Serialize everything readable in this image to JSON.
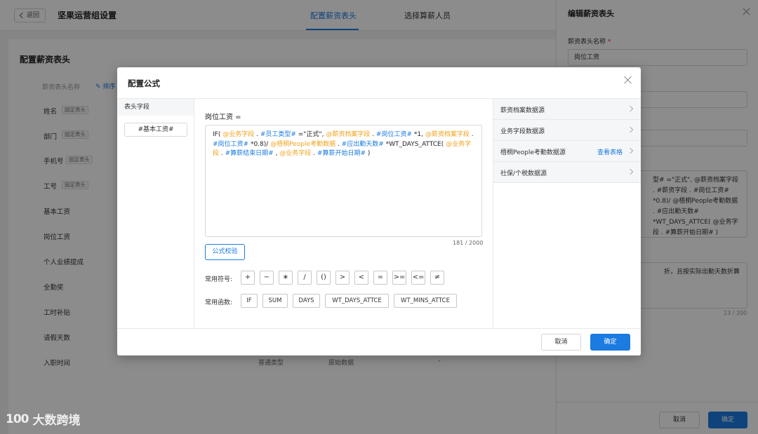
{
  "header": {
    "back_label": "返回",
    "title": "坚果运营组设置",
    "tabs": [
      {
        "label": "配置薪资表头",
        "active": true
      },
      {
        "label": "选择算薪人员",
        "active": false
      }
    ]
  },
  "page": {
    "section_title": "配置薪资表头",
    "column_header": "薪资表头名称",
    "sort_label": "排序",
    "fixed_tag": "固定表头",
    "rows": [
      "姓名",
      "部门",
      "手机号",
      "工号",
      "基本工资",
      "岗位工资",
      "个人业绩提成",
      "全勤奖",
      "工时补贴",
      "请假天数",
      "入职时间"
    ],
    "last_row": {
      "type": "普通类型",
      "source": "原始数据",
      "extra": "-"
    }
  },
  "drawer": {
    "title": "编辑薪资表头",
    "name_label": "薪资表头名称",
    "name_value": "岗位工资",
    "formula_preview": "型# =\"正式\", @薪资档案字段 . #薪资字段 . #岗位工资# *0.8)/ @梧桐People考勤数据 . #应出勤天数# *WT_DAYS_ATTCE( @业务字段 . #算薪开始日期# )",
    "note_text": "折，且按实际出勤天数折算",
    "note_count": "23 / 200",
    "cancel_label": "取消",
    "ok_label": "确定"
  },
  "modal": {
    "title": "配置公式",
    "left_header": "表头字段",
    "field_chip": "#基本工资#",
    "formula_label": "岗位工资 =",
    "formula_tokens": [
      {
        "t": "IF( ",
        "k": "plain"
      },
      {
        "t": "@业务字段",
        "k": "var"
      },
      {
        "t": " . ",
        "k": "plain"
      },
      {
        "t": "#员工类型#",
        "k": "field"
      },
      {
        "t": " =\"正式\", ",
        "k": "plain"
      },
      {
        "t": "@薪资档案字段",
        "k": "var"
      },
      {
        "t": " . ",
        "k": "plain"
      },
      {
        "t": "#岗位工资#",
        "k": "field"
      },
      {
        "t": " *1, ",
        "k": "plain"
      },
      {
        "t": "@薪资档案字段",
        "k": "var"
      },
      {
        "t": " . ",
        "k": "plain"
      },
      {
        "t": "#岗位工资#",
        "k": "field"
      },
      {
        "t": " *0.8)/ ",
        "k": "plain"
      },
      {
        "t": "@梧桐People考勤数据",
        "k": "var"
      },
      {
        "t": " . ",
        "k": "plain"
      },
      {
        "t": "#应出勤天数#",
        "k": "field"
      },
      {
        "t": " *WT_DAYS_ATTCE( ",
        "k": "plain"
      },
      {
        "t": "@业务字段",
        "k": "var"
      },
      {
        "t": " . ",
        "k": "plain"
      },
      {
        "t": "#算薪结束日期#",
        "k": "field"
      },
      {
        "t": " , ",
        "k": "plain"
      },
      {
        "t": "@业务字段",
        "k": "var"
      },
      {
        "t": " . ",
        "k": "plain"
      },
      {
        "t": "#算薪开始日期#",
        "k": "field"
      },
      {
        "t": " )",
        "k": "plain"
      }
    ],
    "char_count": "181 / 2000",
    "validate_label": "公式校验",
    "symbols_label": "常用符号:",
    "symbols": [
      "+",
      "−",
      "∗",
      "/",
      "()",
      ">",
      "<",
      "=",
      ">=",
      "<=",
      "≠"
    ],
    "functions_label": "常用函数:",
    "functions": [
      "IF",
      "SUM",
      "DAYS",
      "WT_DAYS_ATTCE",
      "WT_MINS_ATTCE"
    ],
    "sources": [
      {
        "label": "薪资档案数据源",
        "link": ""
      },
      {
        "label": "业务字段数据源",
        "link": ""
      },
      {
        "label": "梧桐People考勤数据源",
        "link": "查看表格"
      },
      {
        "label": "社保/个税数据源",
        "link": ""
      }
    ],
    "cancel_label": "取消",
    "ok_label": "确定"
  },
  "watermark": {
    "logo": "100",
    "text": "大数跨境"
  },
  "colors": {
    "accent": "#1b7be0",
    "variable": "#f0a21c",
    "overlay": "rgba(0,0,0,0.45)"
  }
}
